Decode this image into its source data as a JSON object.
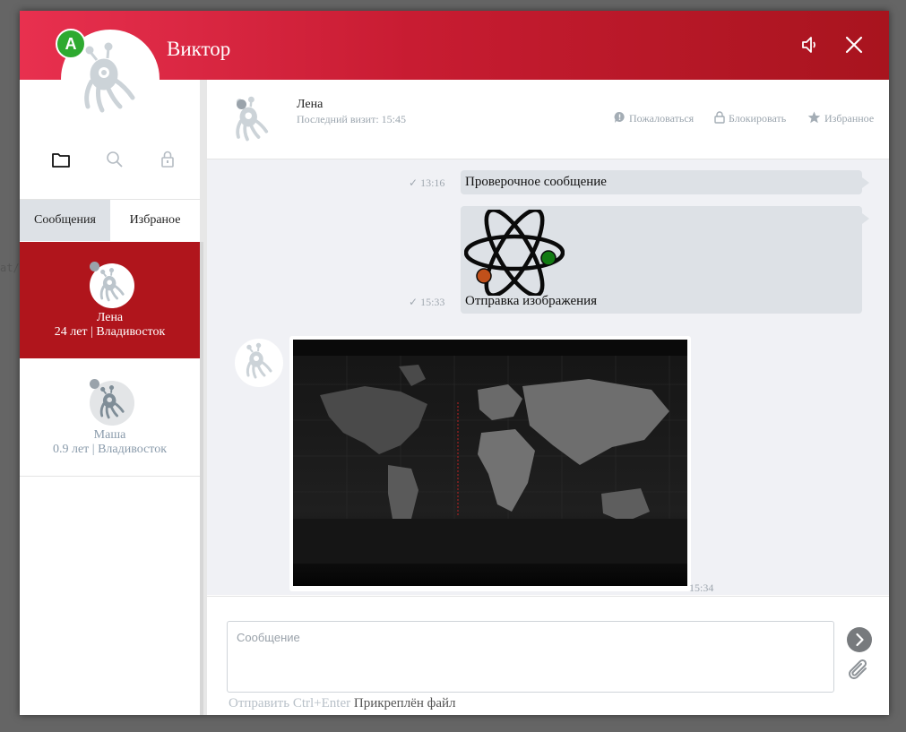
{
  "background": {
    "code_fragment": "at/"
  },
  "header": {
    "title": "Виктор",
    "badge_letter": "A"
  },
  "sidebar": {
    "tabs": [
      {
        "label": "Сообщения",
        "active": true
      },
      {
        "label": "Избраное",
        "active": false
      }
    ],
    "contacts": [
      {
        "name": "Лена",
        "info": "24 лет | Владивосток",
        "selected": true
      },
      {
        "name": "Маша",
        "info": "0.9 лет | Владивосток",
        "selected": false
      }
    ]
  },
  "chat": {
    "name": "Лена",
    "status": "Последний визит: 15:45",
    "actions": {
      "report": "Пожаловаться",
      "block": "Блокировать",
      "favorite": "Избранное"
    }
  },
  "messages": [
    {
      "time": "13:16",
      "check": "✓",
      "text": "Проверочное сообщение"
    },
    {
      "time": "15:33",
      "check": "✓",
      "text": "Отправка изображения"
    },
    {
      "time": "15:34"
    }
  ],
  "compose": {
    "placeholder": "Сообщение",
    "send_hint": "Отправить Ctrl+Enter",
    "file_hint": "Прикреплён файл"
  },
  "colors": {
    "header_start": "#e8304f",
    "header_end": "#a8141e",
    "selected_contact": "#b0151c",
    "online_badge": "#2eaa30",
    "bubble": "#dde1e6"
  }
}
